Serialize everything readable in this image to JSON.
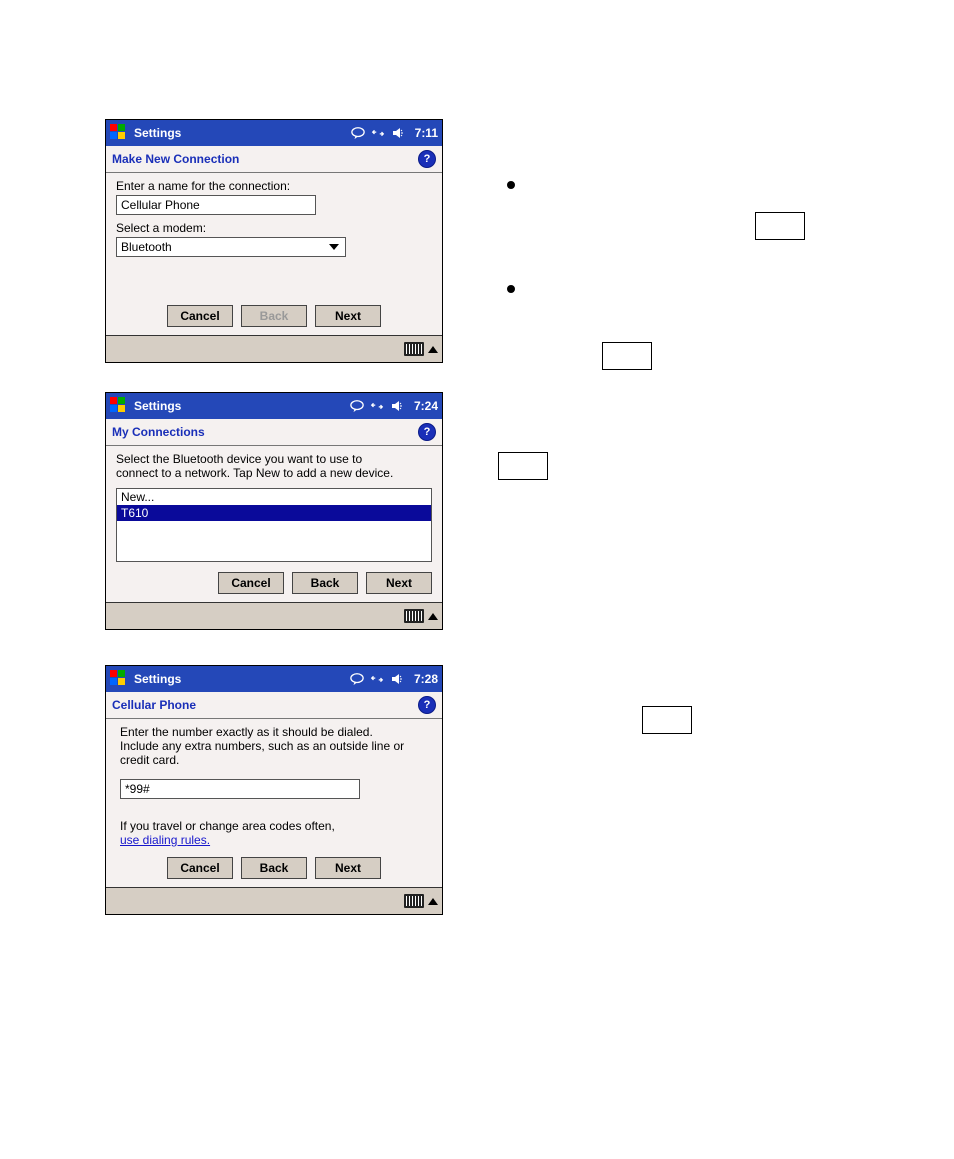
{
  "screenshots": {
    "s1": {
      "title": "Settings",
      "time": "7:11",
      "subtitle": "Make New Connection",
      "label_name": "Enter a name for the connection:",
      "input_name": "Cellular Phone",
      "label_modem": "Select a modem:",
      "input_modem": "Bluetooth",
      "btn_cancel": "Cancel",
      "btn_back": "Back",
      "btn_next": "Next"
    },
    "s2": {
      "title": "Settings",
      "time": "7:24",
      "subtitle": "My Connections",
      "instructions": "Select the Bluetooth device you want to use to connect to a network. Tap New to add a new device.",
      "list_new": "New...",
      "list_selected": "T610",
      "btn_cancel": "Cancel",
      "btn_back": "Back",
      "btn_next": "Next"
    },
    "s3": {
      "title": "Settings",
      "time": "7:28",
      "subtitle": "Cellular Phone",
      "instructions": "Enter the number exactly as it should be dialed.  Include any extra numbers, such as an outside line or credit card.",
      "input_number": "*99#",
      "travel_text": "If you travel or change area codes often,",
      "link_text": "use dialing rules.",
      "btn_cancel": "Cancel",
      "btn_back": "Back",
      "btn_next": "Next"
    }
  },
  "icons": {
    "help": "?"
  }
}
